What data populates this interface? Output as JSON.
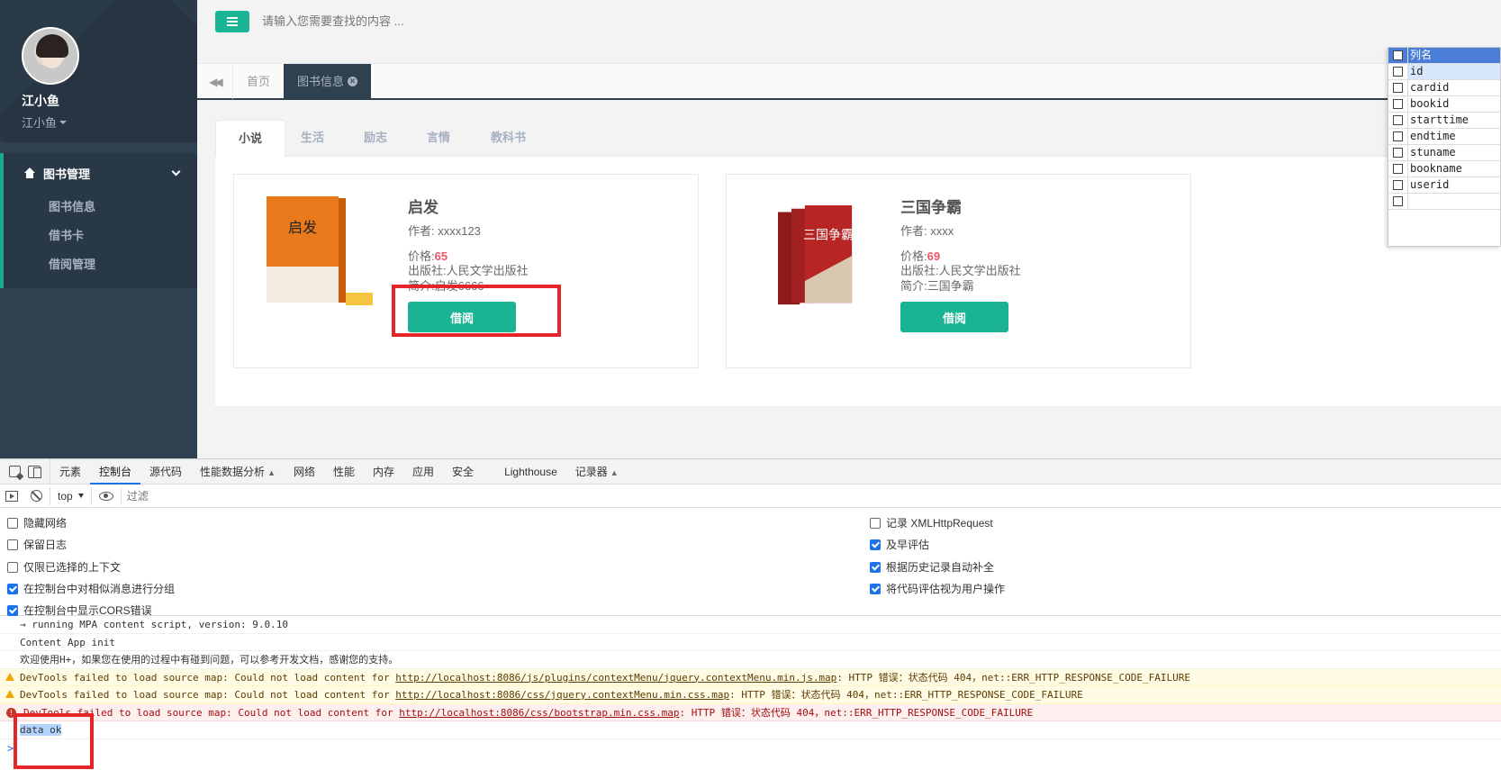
{
  "user": {
    "name": "江小鱼",
    "role": "江小鱼"
  },
  "sidebar": {
    "group_label": "图书管理",
    "items": [
      {
        "label": "图书信息"
      },
      {
        "label": "借书卡"
      },
      {
        "label": "借阅管理"
      }
    ]
  },
  "topbar": {
    "search_placeholder": "请输入您需要查找的内容 ..."
  },
  "page_tabs": {
    "home": "首页",
    "active": "图书信息"
  },
  "categories": [
    "小说",
    "生活",
    "励志",
    "言情",
    "教科书"
  ],
  "books": [
    {
      "title": "启发",
      "author": "作者: xxxx123",
      "price_label": "价格:",
      "price": "65",
      "publisher": "出版社:人民文学出版社",
      "intro": "简介:启发6666",
      "button": "借阅",
      "cover_text": "启发"
    },
    {
      "title": "三国争霸",
      "author": "作者: xxxx",
      "price_label": "价格:",
      "price": "69",
      "publisher": "出版社:人民文学出版社",
      "intro": "简介:三国争霸",
      "button": "借阅",
      "cover_text": "三国争霸"
    }
  ],
  "column_chooser": {
    "header": "列名",
    "columns": [
      "id",
      "cardid",
      "bookid",
      "starttime",
      "endtime",
      "stuname",
      "bookname",
      "userid",
      ""
    ]
  },
  "devtools": {
    "tabs": [
      "元素",
      "控制台",
      "源代码",
      "性能数据分析",
      "网络",
      "性能",
      "内存",
      "应用",
      "安全",
      "Lighthouse",
      "记录器"
    ],
    "context": "top",
    "filter_placeholder": "过滤",
    "settings_left": [
      {
        "label": "隐藏网络",
        "checked": false
      },
      {
        "label": "保留日志",
        "checked": false
      },
      {
        "label": "仅限已选择的上下文",
        "checked": false
      },
      {
        "label": "在控制台中对相似消息进行分组",
        "checked": true
      },
      {
        "label": "在控制台中显示CORS错误",
        "checked": true
      }
    ],
    "settings_right": [
      {
        "label": "记录 XMLHttpRequest",
        "checked": false
      },
      {
        "label": "及早评估",
        "checked": true
      },
      {
        "label": "根据历史记录自动补全",
        "checked": true
      },
      {
        "label": "将代码评估视为用户操作",
        "checked": true
      }
    ],
    "console_lines": [
      {
        "type": "log",
        "text": "→ running MPA content script, version: 9.0.10"
      },
      {
        "type": "log",
        "text": "Content App init"
      },
      {
        "type": "log",
        "text": "欢迎使用H+，如果您在使用的过程中有碰到问题，可以参考开发文档，感谢您的支持。"
      },
      {
        "type": "warn",
        "prefix": "DevTools failed to load source map: Could not load content for ",
        "link": "http://localhost:8086/js/plugins/contextMenu/jquery.contextMenu.min.js.map",
        "suffix": ": HTTP 错误：状态代码 404，net::ERR_HTTP_RESPONSE_CODE_FAILURE"
      },
      {
        "type": "warn",
        "prefix": "DevTools failed to load source map: Could not load content for ",
        "link": "http://localhost:8086/css/jquery.contextMenu.min.css.map",
        "suffix": ": HTTP 错误：状态代码 404，net::ERR_HTTP_RESPONSE_CODE_FAILURE"
      },
      {
        "type": "err",
        "prefix": "DevTools failed to load source map: Could not load content for ",
        "link": "http://localhost:8086/css/bootstrap.min.css.map",
        "suffix": ": HTTP 错误：状态代码 404，net::ERR_HTTP_RESPONSE_CODE_FAILURE"
      },
      {
        "type": "log",
        "text": "data ok"
      }
    ],
    "prompt": ">"
  }
}
